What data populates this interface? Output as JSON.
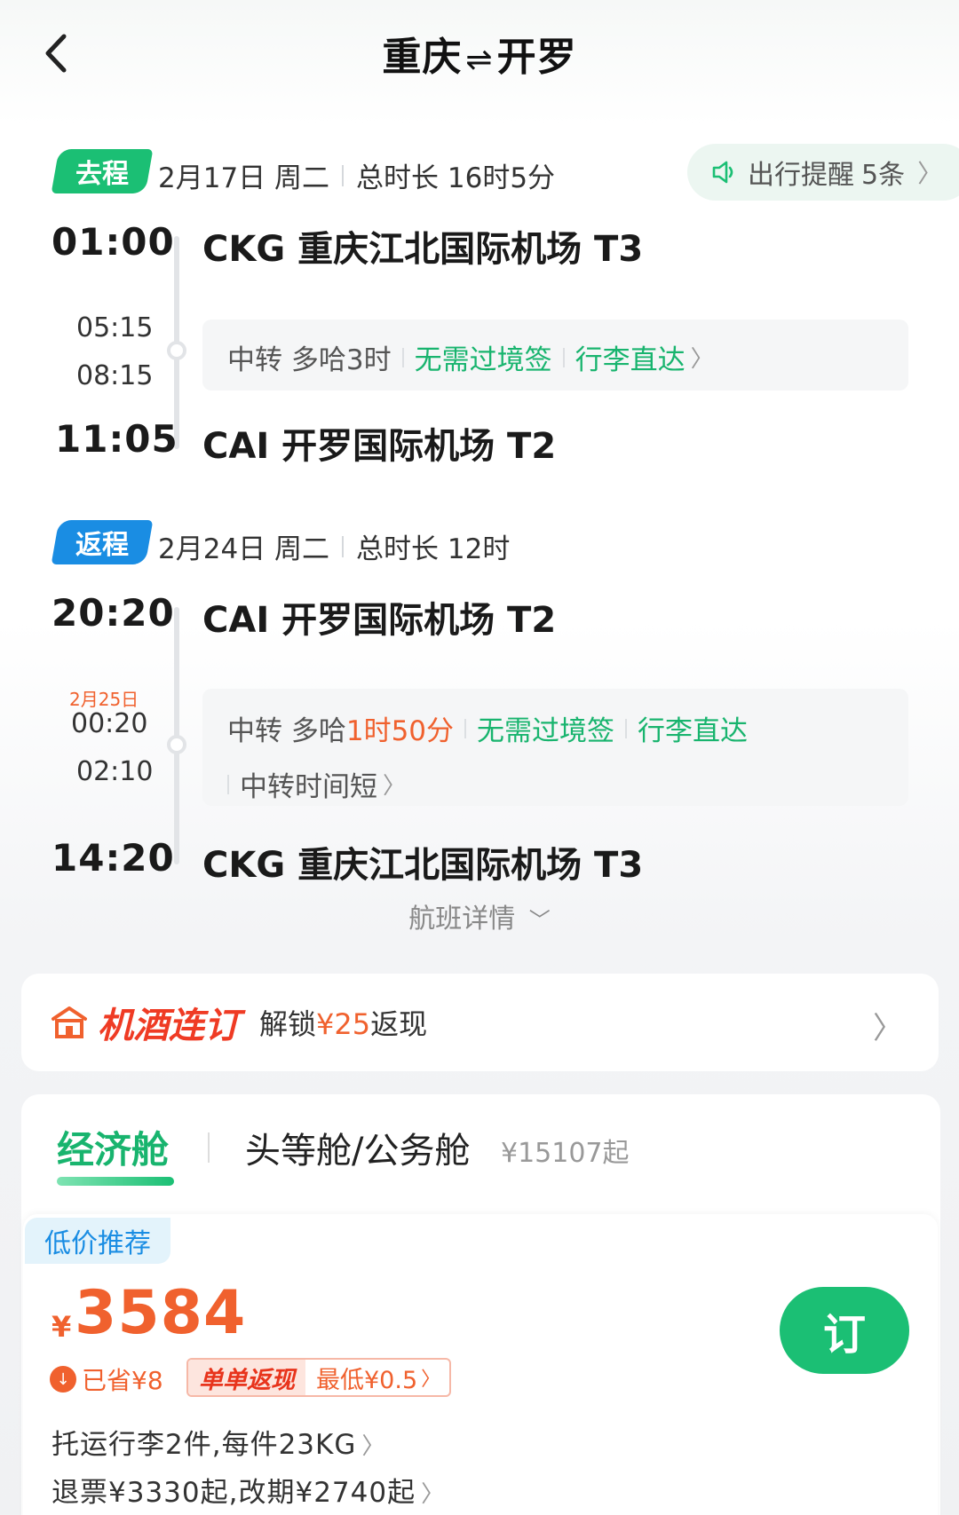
{
  "header": {
    "origin": "重庆",
    "arrow": "⇌",
    "destination": "开罗"
  },
  "reminder": {
    "label": "出行提醒",
    "count": "5条"
  },
  "outbound": {
    "badge": "去程",
    "date": "2月17日 周二",
    "duration": "总时长 16时5分",
    "depart_time": "01:00",
    "depart_airport": "CKG 重庆江北国际机场 T3",
    "transfer_arrive": "05:15",
    "transfer_depart": "08:15",
    "transfer_prefix": "中转 多哈",
    "transfer_duration": "3时",
    "visa": "无需过境签",
    "baggage": "行李直达",
    "arrive_time": "11:05",
    "arrive_airport": "CAI 开罗国际机场 T2"
  },
  "return": {
    "badge": "返程",
    "date": "2月24日 周二",
    "duration": "总时长 12时",
    "depart_time": "20:20",
    "depart_airport": "CAI 开罗国际机场 T2",
    "transfer_date": "2月25日",
    "transfer_arrive": "00:20",
    "transfer_depart": "02:10",
    "transfer_prefix": "中转 多哈",
    "transfer_duration": "1时50分",
    "visa": "无需过境签",
    "baggage": "行李直达",
    "transfer_note": "中转时间短",
    "arrive_time": "14:20",
    "arrive_airport": "CKG 重庆江北国际机场 T3"
  },
  "flight_details": "航班详情",
  "hotel_bundle": {
    "title": "机酒连订",
    "sub_prefix": "解锁",
    "amount": "¥25",
    "sub_suffix": "返现"
  },
  "cabin_tabs": {
    "economy": "经济舱",
    "business": "头等舱/公务舱",
    "business_price": "¥15107起"
  },
  "fare": {
    "tag": "低价推荐",
    "currency": "¥",
    "price": "3584",
    "saved": "已省¥8",
    "cashback_label": "单单返现",
    "cashback_value": "最低¥0.5",
    "book": "订",
    "baggage": "托运行李2件,每件23KG",
    "refund": "退票¥3330起,改期¥2740起"
  },
  "colors": {
    "green": "#1bbf74",
    "blue": "#1a8de3",
    "orange": "#f0612e",
    "red": "#ef3b24"
  }
}
